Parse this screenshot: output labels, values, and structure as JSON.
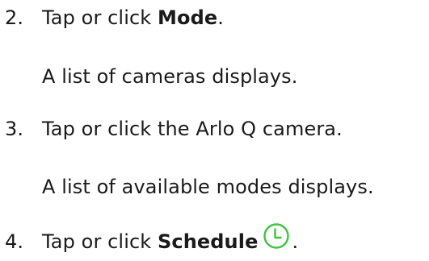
{
  "steps": [
    {
      "number": "2.",
      "pre": "Tap or click ",
      "bold": "Mode",
      "post": ".",
      "result": "A list of cameras displays."
    },
    {
      "number": "3.",
      "text": "Tap or click the Arlo Q camera.",
      "result": "A list of available modes displays."
    },
    {
      "number": "4.",
      "pre": "Tap or click ",
      "bold": "Schedule",
      "post": ".",
      "icon": "clock-icon"
    }
  ],
  "colors": {
    "text": "#1a1a1a",
    "icon": "#3fc33f"
  }
}
